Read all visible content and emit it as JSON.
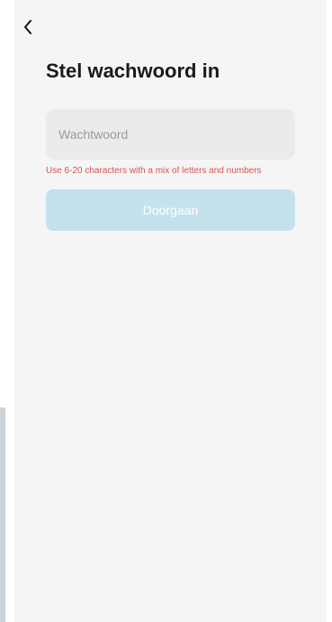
{
  "header": {
    "back_icon": "chevron-left-icon"
  },
  "title": "Stel wachwoord in",
  "password": {
    "value": "",
    "placeholder": "Wachtwoord"
  },
  "hint": "Use 6-20 characters with a mix of letters and numbers",
  "continue_label": "Doorgaan",
  "colors": {
    "background": "#f5f5f5",
    "field_background": "#ebebeb",
    "hint": "#d9534f",
    "button_disabled": "#c4e2ee"
  }
}
